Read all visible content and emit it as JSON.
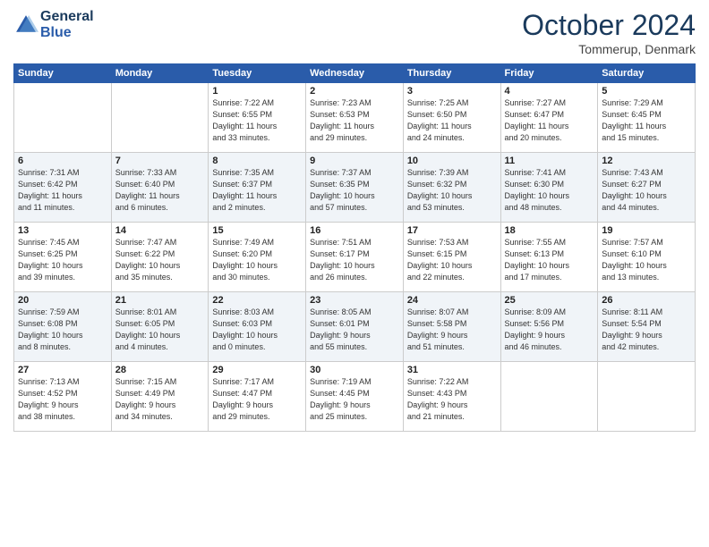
{
  "logo": {
    "line1": "General",
    "line2": "Blue"
  },
  "title": "October 2024",
  "location": "Tommerup, Denmark",
  "weekdays": [
    "Sunday",
    "Monday",
    "Tuesday",
    "Wednesday",
    "Thursday",
    "Friday",
    "Saturday"
  ],
  "weeks": [
    [
      {
        "day": "",
        "text": ""
      },
      {
        "day": "",
        "text": ""
      },
      {
        "day": "1",
        "text": "Sunrise: 7:22 AM\nSunset: 6:55 PM\nDaylight: 11 hours\nand 33 minutes."
      },
      {
        "day": "2",
        "text": "Sunrise: 7:23 AM\nSunset: 6:53 PM\nDaylight: 11 hours\nand 29 minutes."
      },
      {
        "day": "3",
        "text": "Sunrise: 7:25 AM\nSunset: 6:50 PM\nDaylight: 11 hours\nand 24 minutes."
      },
      {
        "day": "4",
        "text": "Sunrise: 7:27 AM\nSunset: 6:47 PM\nDaylight: 11 hours\nand 20 minutes."
      },
      {
        "day": "5",
        "text": "Sunrise: 7:29 AM\nSunset: 6:45 PM\nDaylight: 11 hours\nand 15 minutes."
      }
    ],
    [
      {
        "day": "6",
        "text": "Sunrise: 7:31 AM\nSunset: 6:42 PM\nDaylight: 11 hours\nand 11 minutes."
      },
      {
        "day": "7",
        "text": "Sunrise: 7:33 AM\nSunset: 6:40 PM\nDaylight: 11 hours\nand 6 minutes."
      },
      {
        "day": "8",
        "text": "Sunrise: 7:35 AM\nSunset: 6:37 PM\nDaylight: 11 hours\nand 2 minutes."
      },
      {
        "day": "9",
        "text": "Sunrise: 7:37 AM\nSunset: 6:35 PM\nDaylight: 10 hours\nand 57 minutes."
      },
      {
        "day": "10",
        "text": "Sunrise: 7:39 AM\nSunset: 6:32 PM\nDaylight: 10 hours\nand 53 minutes."
      },
      {
        "day": "11",
        "text": "Sunrise: 7:41 AM\nSunset: 6:30 PM\nDaylight: 10 hours\nand 48 minutes."
      },
      {
        "day": "12",
        "text": "Sunrise: 7:43 AM\nSunset: 6:27 PM\nDaylight: 10 hours\nand 44 minutes."
      }
    ],
    [
      {
        "day": "13",
        "text": "Sunrise: 7:45 AM\nSunset: 6:25 PM\nDaylight: 10 hours\nand 39 minutes."
      },
      {
        "day": "14",
        "text": "Sunrise: 7:47 AM\nSunset: 6:22 PM\nDaylight: 10 hours\nand 35 minutes."
      },
      {
        "day": "15",
        "text": "Sunrise: 7:49 AM\nSunset: 6:20 PM\nDaylight: 10 hours\nand 30 minutes."
      },
      {
        "day": "16",
        "text": "Sunrise: 7:51 AM\nSunset: 6:17 PM\nDaylight: 10 hours\nand 26 minutes."
      },
      {
        "day": "17",
        "text": "Sunrise: 7:53 AM\nSunset: 6:15 PM\nDaylight: 10 hours\nand 22 minutes."
      },
      {
        "day": "18",
        "text": "Sunrise: 7:55 AM\nSunset: 6:13 PM\nDaylight: 10 hours\nand 17 minutes."
      },
      {
        "day": "19",
        "text": "Sunrise: 7:57 AM\nSunset: 6:10 PM\nDaylight: 10 hours\nand 13 minutes."
      }
    ],
    [
      {
        "day": "20",
        "text": "Sunrise: 7:59 AM\nSunset: 6:08 PM\nDaylight: 10 hours\nand 8 minutes."
      },
      {
        "day": "21",
        "text": "Sunrise: 8:01 AM\nSunset: 6:05 PM\nDaylight: 10 hours\nand 4 minutes."
      },
      {
        "day": "22",
        "text": "Sunrise: 8:03 AM\nSunset: 6:03 PM\nDaylight: 10 hours\nand 0 minutes."
      },
      {
        "day": "23",
        "text": "Sunrise: 8:05 AM\nSunset: 6:01 PM\nDaylight: 9 hours\nand 55 minutes."
      },
      {
        "day": "24",
        "text": "Sunrise: 8:07 AM\nSunset: 5:58 PM\nDaylight: 9 hours\nand 51 minutes."
      },
      {
        "day": "25",
        "text": "Sunrise: 8:09 AM\nSunset: 5:56 PM\nDaylight: 9 hours\nand 46 minutes."
      },
      {
        "day": "26",
        "text": "Sunrise: 8:11 AM\nSunset: 5:54 PM\nDaylight: 9 hours\nand 42 minutes."
      }
    ],
    [
      {
        "day": "27",
        "text": "Sunrise: 7:13 AM\nSunset: 4:52 PM\nDaylight: 9 hours\nand 38 minutes."
      },
      {
        "day": "28",
        "text": "Sunrise: 7:15 AM\nSunset: 4:49 PM\nDaylight: 9 hours\nand 34 minutes."
      },
      {
        "day": "29",
        "text": "Sunrise: 7:17 AM\nSunset: 4:47 PM\nDaylight: 9 hours\nand 29 minutes."
      },
      {
        "day": "30",
        "text": "Sunrise: 7:19 AM\nSunset: 4:45 PM\nDaylight: 9 hours\nand 25 minutes."
      },
      {
        "day": "31",
        "text": "Sunrise: 7:22 AM\nSunset: 4:43 PM\nDaylight: 9 hours\nand 21 minutes."
      },
      {
        "day": "",
        "text": ""
      },
      {
        "day": "",
        "text": ""
      }
    ]
  ]
}
